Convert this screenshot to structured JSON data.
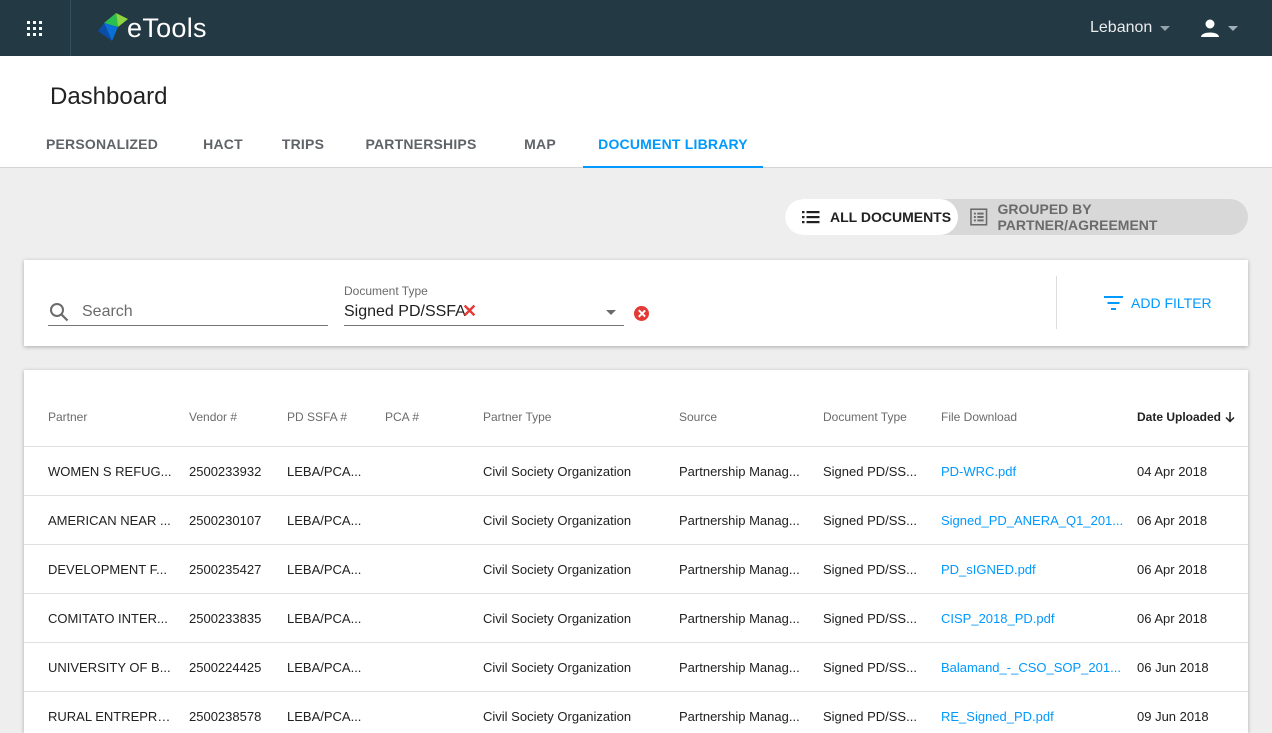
{
  "topbar": {
    "app_name": "eTools",
    "country": "Lebanon"
  },
  "header": {
    "title": "Dashboard",
    "tabs": [
      {
        "label": "PERSONALIZED"
      },
      {
        "label": "HACT"
      },
      {
        "label": "TRIPS"
      },
      {
        "label": "PARTNERSHIPS"
      },
      {
        "label": "MAP"
      },
      {
        "label": "DOCUMENT LIBRARY",
        "active": true
      }
    ]
  },
  "view_toggle": {
    "all_label": "ALL DOCUMENTS",
    "grouped_label": "GROUPED BY PARTNER/AGREEMENT",
    "selected": "ALL DOCUMENTS"
  },
  "filters": {
    "search_placeholder": "Search",
    "document_type_label": "Document Type",
    "document_type_value": "Signed PD/SSFA",
    "add_filter_label": "ADD FILTER"
  },
  "table": {
    "columns": [
      "Partner",
      "Vendor #",
      "PD SSFA #",
      "PCA #",
      "Partner Type",
      "Source",
      "Document Type",
      "File Download",
      "Date Uploaded"
    ],
    "sort": {
      "column": "Date Uploaded",
      "direction": "desc"
    },
    "rows": [
      {
        "partner": "WOMEN S REFUG...",
        "vendor": "2500233932",
        "pd_ssfa": "LEBA/PCA...",
        "pca": "",
        "partner_type": "Civil Society Organization",
        "source": "Partnership Manag...",
        "doc_type": "Signed PD/SS...",
        "file": "PD-WRC.pdf",
        "date": "04 Apr 2018"
      },
      {
        "partner": "AMERICAN NEAR ...",
        "vendor": "2500230107",
        "pd_ssfa": "LEBA/PCA...",
        "pca": "",
        "partner_type": "Civil Society Organization",
        "source": "Partnership Manag...",
        "doc_type": "Signed PD/SS...",
        "file": "Signed_PD_ANERA_Q1_201...",
        "date": "06 Apr 2018"
      },
      {
        "partner": "DEVELOPMENT F...",
        "vendor": "2500235427",
        "pd_ssfa": "LEBA/PCA...",
        "pca": "",
        "partner_type": "Civil Society Organization",
        "source": "Partnership Manag...",
        "doc_type": "Signed PD/SS...",
        "file": "PD_sIGNED.pdf",
        "date": "06 Apr 2018"
      },
      {
        "partner": "COMITATO INTER...",
        "vendor": "2500233835",
        "pd_ssfa": "LEBA/PCA...",
        "pca": "",
        "partner_type": "Civil Society Organization",
        "source": "Partnership Manag...",
        "doc_type": "Signed PD/SS...",
        "file": "CISP_2018_PD.pdf",
        "date": "06 Apr 2018"
      },
      {
        "partner": "UNIVERSITY OF B...",
        "vendor": "2500224425",
        "pd_ssfa": "LEBA/PCA...",
        "pca": "",
        "partner_type": "Civil Society Organization",
        "source": "Partnership Manag...",
        "doc_type": "Signed PD/SS...",
        "file": "Balamand_-_CSO_SOP_201...",
        "date": "06 Jun 2018"
      },
      {
        "partner": "RURAL ENTREPRE...",
        "vendor": "2500238578",
        "pd_ssfa": "LEBA/PCA...",
        "pca": "",
        "partner_type": "Civil Society Organization",
        "source": "Partnership Manag...",
        "doc_type": "Signed PD/SS...",
        "file": "RE_Signed_PD.pdf",
        "date": "09 Jun 2018"
      }
    ]
  },
  "colors": {
    "topbar": "#233944",
    "accent": "#0099ff",
    "clear": "#e53935"
  },
  "icons": [
    "apps-grid-icon",
    "etools-logo-icon",
    "chevron-down-icon",
    "account-icon",
    "list-icon",
    "grouped-list-icon",
    "search-icon",
    "remove-chip-icon",
    "clear-filter-icon",
    "filter-icon",
    "arrow-down-icon"
  ]
}
